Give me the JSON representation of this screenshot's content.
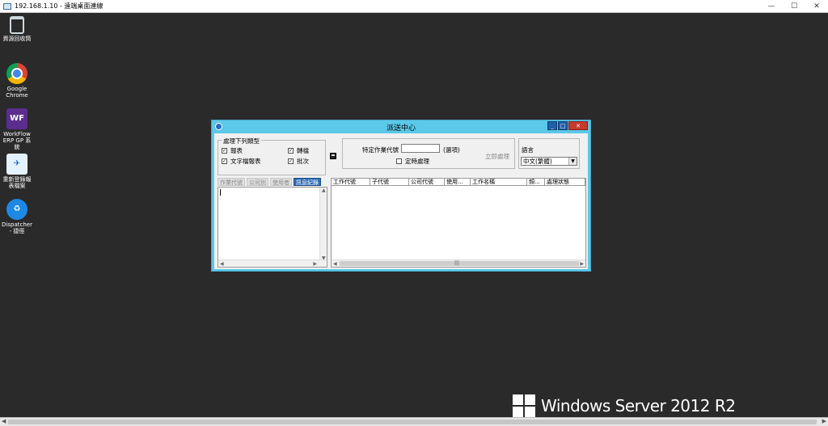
{
  "rdp": {
    "title": "192.168.1.10 - 遠端桌面連線",
    "controls": [
      "—",
      "☐",
      "✕"
    ]
  },
  "desktop_icons": [
    {
      "label": "資源回收筒",
      "icon": "recycle-bin-icon"
    },
    {
      "label": "Google Chrome",
      "icon": "chrome-icon"
    },
    {
      "label": "WorkFlow ERP GP 系統",
      "icon": "workflow-erp-icon",
      "glyph": "WF"
    },
    {
      "label": "重新登錄報表檔案",
      "icon": "report-icon"
    },
    {
      "label": "Dispatcher - 捷徑",
      "icon": "dispatcher-icon"
    }
  ],
  "app": {
    "title": "派送中心",
    "controls": [
      "_",
      "□",
      "✕"
    ],
    "process_group": {
      "legend": "處理下列類型",
      "items": [
        {
          "label": "報表",
          "checked": true
        },
        {
          "label": "文字檔報表",
          "checked": true
        },
        {
          "label": "轉檔",
          "checked": true
        },
        {
          "label": "批次",
          "checked": true
        }
      ]
    },
    "job": {
      "specific_label": "特定作業代號",
      "specific_value": "",
      "optional_label": "(選項)",
      "timed_label": "定時處理",
      "timed_checked": false,
      "run_now_label": "立即處理"
    },
    "language": {
      "legend": "語言",
      "selected": "中文(繁體)"
    },
    "tabs": [
      {
        "label": "作業代號",
        "active": false
      },
      {
        "label": "公司別",
        "active": false
      },
      {
        "label": "使用者",
        "active": false
      },
      {
        "label": "訊息紀錄",
        "active": true
      }
    ],
    "grid_columns": [
      "工作代號",
      "子代號",
      "公司代號",
      "使用...",
      "工作名稱",
      "頻...",
      "處理狀態"
    ]
  },
  "os": {
    "brand": "Windows Server 2012 R2"
  }
}
